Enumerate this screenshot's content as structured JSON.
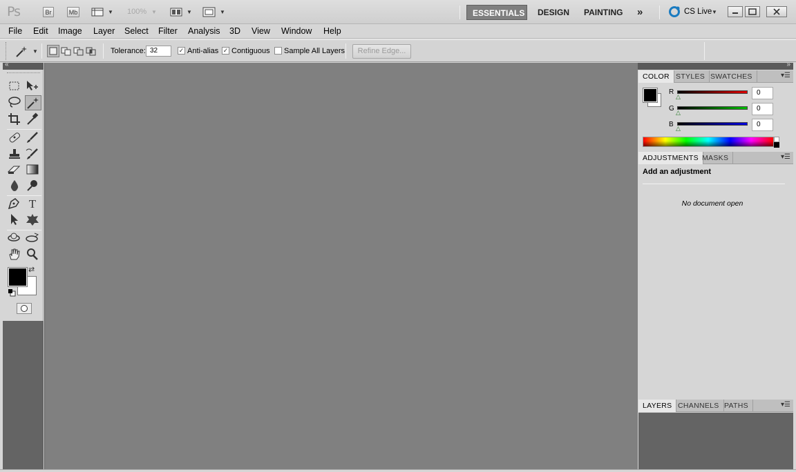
{
  "app": {
    "logo": "Ps",
    "bridge_label": "Br",
    "minibridge_label": "Mb",
    "zoom": "100%",
    "workspaces": [
      "ESSENTIALS",
      "DESIGN",
      "PAINTING"
    ],
    "more_workspaces": "»",
    "cs_live": "CS Live"
  },
  "menu": [
    "File",
    "Edit",
    "Image",
    "Layer",
    "Select",
    "Filter",
    "Analysis",
    "3D",
    "View",
    "Window",
    "Help"
  ],
  "options": {
    "tolerance_label": "Tolerance:",
    "tolerance_value": "32",
    "anti_alias_label": "Anti-alias",
    "anti_alias_checked": true,
    "contiguous_label": "Contiguous",
    "contiguous_checked": true,
    "sample_all_label": "Sample All Layers",
    "sample_all_checked": false,
    "refine_edge": "Refine Edge..."
  },
  "color_panel": {
    "tabs": [
      "COLOR",
      "STYLES",
      "SWATCHES"
    ],
    "channels": [
      {
        "label": "R",
        "value": "0",
        "color": "#e00000"
      },
      {
        "label": "G",
        "value": "0",
        "color": "#00c000"
      },
      {
        "label": "B",
        "value": "0",
        "color": "#0000e0"
      }
    ],
    "foreground": "#000000",
    "background": "#ffffff"
  },
  "adjustments_panel": {
    "tabs": [
      "ADJUSTMENTS",
      "MASKS"
    ],
    "heading": "Add an adjustment",
    "empty_message": "No document open"
  },
  "layers_panel": {
    "tabs": [
      "LAYERS",
      "CHANNELS",
      "PATHS"
    ]
  },
  "colors": {
    "canvas": "#808080",
    "active_workspace": "#7f7f7f"
  }
}
